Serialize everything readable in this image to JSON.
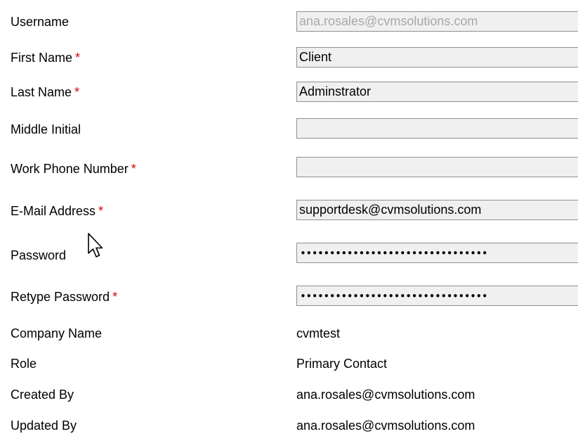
{
  "form": {
    "username": {
      "label": "Username",
      "value": "ana.rosales@cvmsolutions.com"
    },
    "first_name": {
      "label": "First Name",
      "required": "*",
      "value": "Client"
    },
    "last_name": {
      "label": "Last Name",
      "required": "*",
      "value": "Adminstrator"
    },
    "middle_initial": {
      "label": "Middle Initial",
      "value": ""
    },
    "work_phone": {
      "label": "Work Phone Number",
      "required": "*",
      "value": ""
    },
    "email": {
      "label": "E-Mail Address",
      "required": "*",
      "value": "supportdesk@cvmsolutions.com"
    },
    "password": {
      "label": "Password",
      "value": "••••••••••••••••••••••••••••••••"
    },
    "retype_password": {
      "label": "Retype Password",
      "required": "*",
      "value": "••••••••••••••••••••••••••••••••"
    }
  },
  "info": {
    "company_name": {
      "label": "Company Name",
      "value": "cvmtest"
    },
    "role": {
      "label": "Role",
      "value": "Primary Contact"
    },
    "created_by": {
      "label": "Created By",
      "value": "ana.rosales@cvmsolutions.com"
    },
    "updated_by": {
      "label": "Updated By",
      "value": "ana.rosales@cvmsolutions.com"
    }
  },
  "cursor": {
    "icon": "arrow-pointer-icon"
  },
  "colors": {
    "required_marker": "#e00000",
    "input_background": "#f0f0f0",
    "input_border": "#8f8f8f",
    "disabled_text": "#a8a8a8"
  }
}
